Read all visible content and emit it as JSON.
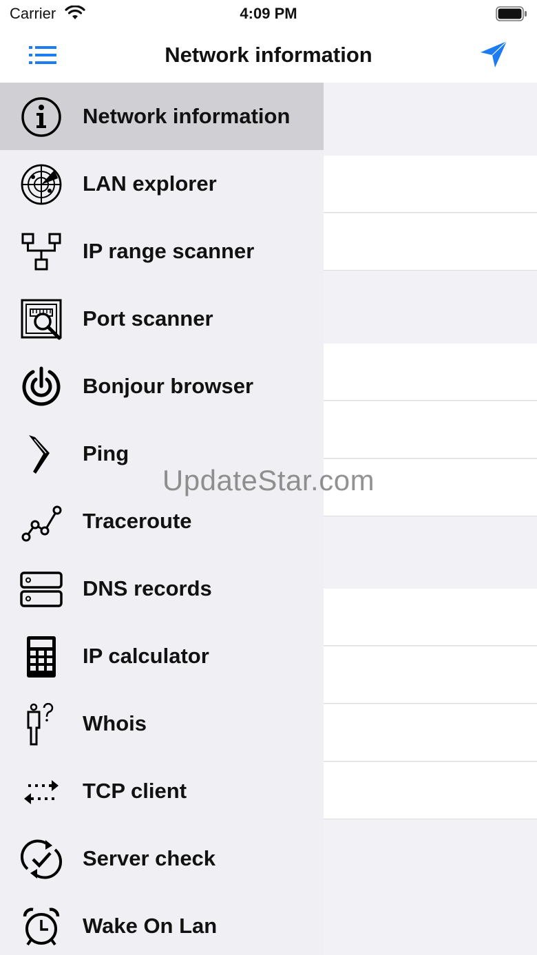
{
  "status_bar": {
    "carrier": "Carrier",
    "time": "4:09 PM"
  },
  "nav": {
    "title": "Network information",
    "accent_color": "#1e7cf2"
  },
  "menu": {
    "items": [
      {
        "label": "Network information",
        "icon": "info-icon",
        "selected": true
      },
      {
        "label": "LAN explorer",
        "icon": "radar-icon"
      },
      {
        "label": "IP range scanner",
        "icon": "network-tree-icon"
      },
      {
        "label": "Port scanner",
        "icon": "port-scan-icon"
      },
      {
        "label": "Bonjour browser",
        "icon": "bonjour-icon"
      },
      {
        "label": "Ping",
        "icon": "boomerang-icon"
      },
      {
        "label": "Traceroute",
        "icon": "route-icon"
      },
      {
        "label": "DNS records",
        "icon": "server-icon"
      },
      {
        "label": "IP calculator",
        "icon": "calculator-icon"
      },
      {
        "label": "Whois",
        "icon": "person-question-icon"
      },
      {
        "label": "TCP client",
        "icon": "exchange-arrows-icon"
      },
      {
        "label": "Server check",
        "icon": "sync-check-icon"
      },
      {
        "label": "Wake On Lan",
        "icon": "alarm-clock-icon"
      }
    ]
  },
  "watermark": "UpdateStar.com"
}
